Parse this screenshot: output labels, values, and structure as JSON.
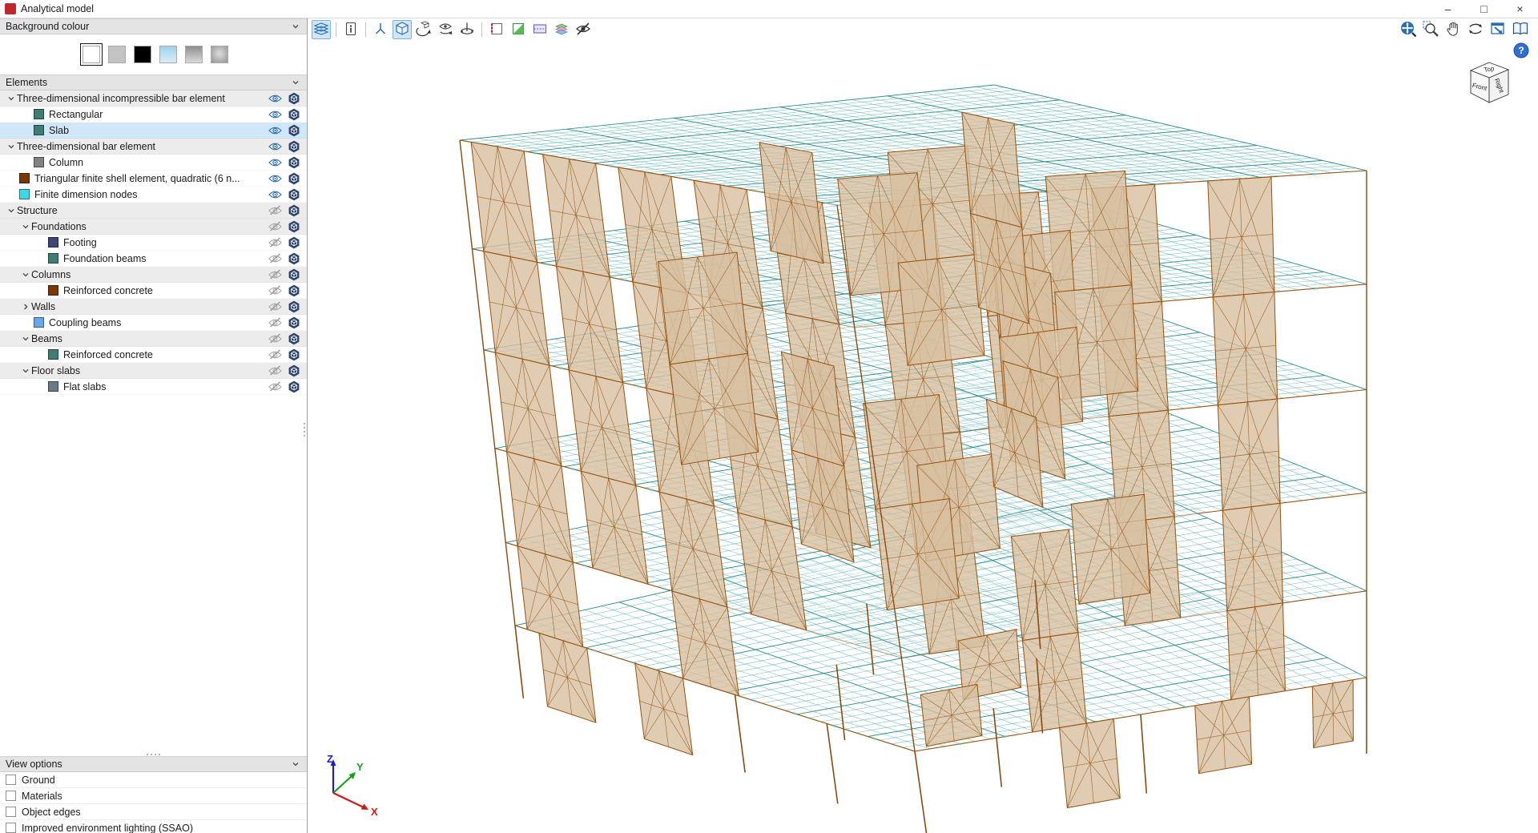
{
  "window": {
    "title": "Analytical model",
    "buttons": [
      {
        "name": "minimize",
        "glyph": "–"
      },
      {
        "name": "maximize",
        "glyph": "□"
      },
      {
        "name": "close",
        "glyph": "×"
      }
    ]
  },
  "sidebar": {
    "background_colour": {
      "label": "Background colour",
      "swatches": [
        "white",
        "light-grey",
        "black",
        "blue-gradient",
        "grey-gradient",
        "radial-grey"
      ],
      "selected_index": 0
    },
    "elements": {
      "label": "Elements",
      "tree": [
        {
          "kind": "group",
          "level": 0,
          "label": "Three-dimensional incompressible bar element",
          "expanded": true,
          "eye": "on"
        },
        {
          "kind": "item",
          "level": 1,
          "label": "Rectangular",
          "swatch": "#3E7E72",
          "eye": "on"
        },
        {
          "kind": "item",
          "level": 1,
          "label": "Slab",
          "swatch": "#3E7E72",
          "eye": "on",
          "selected": true
        },
        {
          "kind": "group",
          "level": 0,
          "label": "Three-dimensional bar element",
          "expanded": true,
          "eye": "on"
        },
        {
          "kind": "item",
          "level": 1,
          "label": "Column",
          "swatch": "#828282",
          "eye": "on"
        },
        {
          "kind": "item",
          "level": 0,
          "label": "Triangular finite shell element, quadratic (6 n...",
          "swatch": "#7B3608",
          "eye": "on"
        },
        {
          "kind": "item",
          "level": 0,
          "label": "Finite dimension nodes",
          "swatch": "#3ED9E9",
          "eye": "on"
        },
        {
          "kind": "group",
          "level": 0,
          "label": "Structure",
          "expanded": true,
          "eye": "off"
        },
        {
          "kind": "group",
          "level": 1,
          "label": "Foundations",
          "expanded": true,
          "eye": "off"
        },
        {
          "kind": "item",
          "level": 2,
          "label": "Footing",
          "swatch": "#3E4678",
          "eye": "off"
        },
        {
          "kind": "item",
          "level": 2,
          "label": "Foundation beams",
          "swatch": "#3E7E72",
          "eye": "off"
        },
        {
          "kind": "group",
          "level": 1,
          "label": "Columns",
          "expanded": true,
          "eye": "off"
        },
        {
          "kind": "item",
          "level": 2,
          "label": "Reinforced concrete",
          "swatch": "#7B3608",
          "eye": "off"
        },
        {
          "kind": "group",
          "level": 1,
          "label": "Walls",
          "expanded": false,
          "eye": "off"
        },
        {
          "kind": "item",
          "level": 1,
          "label": "Coupling beams",
          "swatch": "#66A9E8",
          "eye": "off"
        },
        {
          "kind": "group",
          "level": 1,
          "label": "Beams",
          "expanded": true,
          "eye": "off"
        },
        {
          "kind": "item",
          "level": 2,
          "label": "Reinforced concrete",
          "swatch": "#3E7E72",
          "eye": "off"
        },
        {
          "kind": "group",
          "level": 1,
          "label": "Floor slabs",
          "expanded": true,
          "eye": "off"
        },
        {
          "kind": "item",
          "level": 2,
          "label": "Flat slabs",
          "swatch": "#6B7B85",
          "eye": "off"
        }
      ]
    },
    "view_options": {
      "label": "View options",
      "items": [
        {
          "label": "Ground",
          "checked": false
        },
        {
          "label": "Materials",
          "checked": false
        },
        {
          "label": "Object edges",
          "checked": false
        },
        {
          "label": "Improved environment lighting (SSAO)",
          "checked": false
        }
      ]
    }
  },
  "toolbar": {
    "items": [
      {
        "name": "slab-planes",
        "active": true,
        "sep_after": true
      },
      {
        "name": "element-info",
        "active": false,
        "sep_after": true
      },
      {
        "name": "local-axes",
        "active": false
      },
      {
        "name": "solid-view",
        "active": true
      },
      {
        "name": "rotate-view",
        "active": false
      },
      {
        "name": "orbit-view",
        "active": false
      },
      {
        "name": "turntable-view",
        "active": false,
        "sep_after": true
      },
      {
        "name": "section-box",
        "active": false
      },
      {
        "name": "clip-plane-green",
        "active": false
      },
      {
        "name": "clip-plane-purple",
        "active": false
      },
      {
        "name": "display-layers",
        "active": false
      },
      {
        "name": "hide-elements",
        "active": false
      }
    ]
  },
  "viewport": {
    "nav": {
      "items": [
        "zoom-extents",
        "zoom-window",
        "pan",
        "orbit",
        "previous-view",
        "open-manual"
      ],
      "help": "help"
    },
    "view_cube": {
      "top": "Top",
      "front": "Front",
      "right": "Right"
    },
    "axes": {
      "x": "X",
      "y": "Y",
      "z": "Z"
    }
  },
  "colors": {
    "selection_row": "#cfe7f8",
    "section_header_bg": "#e4e4e4",
    "toolbar_active_bg": "#cfe6f7",
    "slab_wire": "#40a4a4",
    "wall_fill": "#d7bfa0",
    "wall_line": "#95520f",
    "node": "#2fd9e9",
    "app_icon": "#c0272c"
  }
}
